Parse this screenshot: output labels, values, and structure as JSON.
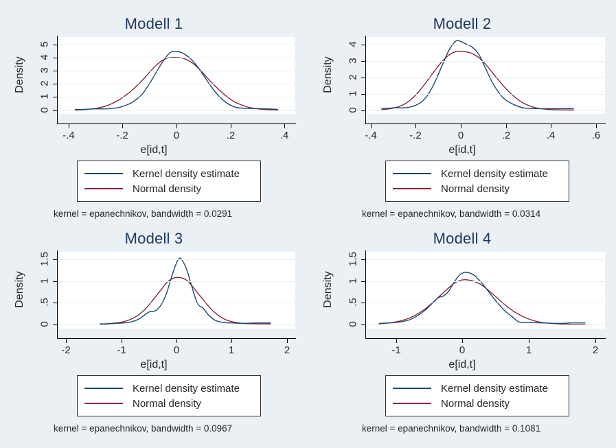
{
  "figure": {
    "background_color": "#eaf0f3",
    "plot_background_color": "#ffffff",
    "title_color": "#1f3864"
  },
  "legend": {
    "kernel_label": "Kernel density estimate",
    "normal_label": "Normal density",
    "kernel_color": "#1a476f",
    "normal_color": "#85293a"
  },
  "panels": [
    {
      "title": "Modell 1",
      "note": "kernel = epanechnikov, bandwidth = 0.0291",
      "xlabel": "e[id,t]",
      "ylabel": "Density",
      "xticks": [
        "-.4",
        "-.2",
        "0",
        ".2",
        ".4"
      ],
      "yticks": [
        "0",
        "1",
        "2",
        "3",
        "4",
        "5"
      ]
    },
    {
      "title": "Modell 2",
      "note": "kernel = epanechnikov, bandwidth = 0.0314",
      "xlabel": "e[id,t]",
      "ylabel": "Density",
      "xticks": [
        "-.4",
        "-.2",
        "0",
        ".2",
        ".4",
        ".6"
      ],
      "yticks": [
        "0",
        "1",
        "2",
        "3",
        "4"
      ]
    },
    {
      "title": "Modell 3",
      "note": "kernel = epanechnikov, bandwidth = 0.0967",
      "xlabel": "e[id,t]",
      "ylabel": "Density",
      "xticks": [
        "-2",
        "-1",
        "0",
        "1",
        "2"
      ],
      "yticks": [
        "0",
        ".5",
        "1",
        "1.5"
      ]
    },
    {
      "title": "Modell 4",
      "note": "kernel = epanechnikov, bandwidth = 0.1081",
      "xlabel": "e[id,t]",
      "ylabel": "Density",
      "xticks": [
        "-1",
        "0",
        "1",
        "2"
      ],
      "yticks": [
        "0",
        ".5",
        "1",
        "1.5"
      ]
    }
  ],
  "chart_data": [
    {
      "type": "line",
      "title": "Modell 1",
      "xlabel": "e[id,t]",
      "ylabel": "Density",
      "xlim": [
        -0.44,
        0.44
      ],
      "ylim": [
        -0.28,
        5.55
      ],
      "xticks": [
        -0.4,
        -0.2,
        0,
        0.2,
        0.4
      ],
      "yticks": [
        0,
        1,
        2,
        3,
        4,
        5
      ],
      "grid": true,
      "legend_position": "below-plot",
      "annotation": "kernel = epanechnikov, bandwidth = 0.0291",
      "series": [
        {
          "name": "Kernel density estimate",
          "color": "#1a476f",
          "x": [
            -0.375,
            -0.34,
            -0.3,
            -0.26,
            -0.22,
            -0.19,
            -0.16,
            -0.13,
            -0.11,
            -0.09,
            -0.07,
            -0.05,
            -0.03,
            -0.015,
            0.0,
            0.015,
            0.03,
            0.05,
            0.07,
            0.09,
            0.11,
            0.13,
            0.16,
            0.19,
            0.22,
            0.26,
            0.3,
            0.34,
            0.375
          ],
          "y": [
            0.05,
            0.06,
            0.1,
            0.1,
            0.18,
            0.35,
            0.65,
            1.15,
            1.7,
            2.35,
            3.05,
            3.7,
            4.25,
            4.45,
            4.45,
            4.4,
            4.25,
            3.95,
            3.5,
            2.95,
            2.35,
            1.75,
            1.0,
            0.5,
            0.22,
            0.14,
            0.12,
            0.1,
            0.06
          ]
        },
        {
          "name": "Normal density",
          "color": "#85293a",
          "x": [
            -0.375,
            -0.34,
            -0.3,
            -0.26,
            -0.22,
            -0.19,
            -0.16,
            -0.13,
            -0.11,
            -0.09,
            -0.07,
            -0.05,
            -0.03,
            -0.015,
            0.0,
            0.015,
            0.03,
            0.05,
            0.07,
            0.09,
            0.11,
            0.13,
            0.16,
            0.19,
            0.22,
            0.26,
            0.3,
            0.34,
            0.375
          ],
          "y": [
            0.02,
            0.05,
            0.13,
            0.32,
            0.7,
            1.1,
            1.6,
            2.2,
            2.65,
            3.1,
            3.5,
            3.8,
            3.97,
            4.0,
            4.0,
            3.98,
            3.9,
            3.7,
            3.4,
            3.0,
            2.55,
            2.1,
            1.5,
            0.98,
            0.58,
            0.26,
            0.1,
            0.04,
            0.02
          ]
        }
      ]
    },
    {
      "type": "line",
      "title": "Modell 2",
      "xlabel": "e[id,t]",
      "ylabel": "Density",
      "xlim": [
        -0.42,
        0.64
      ],
      "ylim": [
        -0.22,
        4.45
      ],
      "xticks": [
        -0.4,
        -0.2,
        0,
        0.2,
        0.4,
        0.6
      ],
      "yticks": [
        0,
        1,
        2,
        3,
        4
      ],
      "grid": true,
      "legend_position": "below-plot",
      "annotation": "kernel = epanechnikov, bandwidth = 0.0314",
      "series": [
        {
          "name": "Kernel density estimate",
          "color": "#1a476f",
          "x": [
            -0.35,
            -0.32,
            -0.29,
            -0.26,
            -0.23,
            -0.2,
            -0.17,
            -0.14,
            -0.11,
            -0.08,
            -0.05,
            -0.02,
            0.0,
            0.02,
            0.05,
            0.08,
            0.11,
            0.14,
            0.17,
            0.2,
            0.24,
            0.28,
            0.33,
            0.38,
            0.43,
            0.48,
            0.5
          ],
          "y": [
            0.12,
            0.12,
            0.16,
            0.14,
            0.18,
            0.3,
            0.55,
            1.05,
            1.85,
            2.8,
            3.7,
            4.22,
            4.18,
            4.05,
            3.85,
            3.4,
            2.55,
            1.7,
            1.05,
            0.62,
            0.32,
            0.14,
            0.1,
            0.1,
            0.1,
            0.1,
            0.1
          ]
        },
        {
          "name": "Normal density",
          "color": "#85293a",
          "x": [
            -0.35,
            -0.32,
            -0.29,
            -0.26,
            -0.23,
            -0.2,
            -0.17,
            -0.14,
            -0.11,
            -0.08,
            -0.05,
            -0.02,
            0.0,
            0.02,
            0.05,
            0.08,
            0.11,
            0.14,
            0.17,
            0.2,
            0.24,
            0.28,
            0.33,
            0.38,
            0.43,
            0.48,
            0.5
          ],
          "y": [
            0.04,
            0.08,
            0.16,
            0.3,
            0.55,
            0.92,
            1.4,
            1.95,
            2.5,
            3.0,
            3.38,
            3.57,
            3.58,
            3.56,
            3.45,
            3.2,
            2.8,
            2.3,
            1.8,
            1.32,
            0.8,
            0.42,
            0.16,
            0.06,
            0.03,
            0.02,
            0.02
          ]
        }
      ]
    },
    {
      "type": "line",
      "title": "Modell 3",
      "xlabel": "e[id,t]",
      "ylabel": "Density",
      "xlim": [
        -2.15,
        2.15
      ],
      "ylim": [
        -0.09,
        1.67
      ],
      "xticks": [
        -2,
        -1,
        0,
        1,
        2
      ],
      "yticks": [
        0,
        0.5,
        1,
        1.5
      ],
      "grid": true,
      "legend_position": "below-plot",
      "annotation": "kernel = epanechnikov, bandwidth = 0.0967",
      "series": [
        {
          "name": "Kernel density estimate",
          "color": "#1a476f",
          "x": [
            -1.38,
            -1.25,
            -1.1,
            -0.95,
            -0.8,
            -0.68,
            -0.58,
            -0.48,
            -0.38,
            -0.28,
            -0.18,
            -0.1,
            -0.02,
            0.05,
            0.1,
            0.18,
            0.26,
            0.34,
            0.4,
            0.48,
            0.58,
            0.7,
            0.85,
            1.0,
            1.2,
            1.45,
            1.7
          ],
          "y": [
            0.02,
            0.02,
            0.03,
            0.04,
            0.07,
            0.13,
            0.22,
            0.3,
            0.32,
            0.45,
            0.72,
            1.05,
            1.35,
            1.52,
            1.48,
            1.28,
            0.95,
            0.62,
            0.45,
            0.38,
            0.22,
            0.1,
            0.05,
            0.04,
            0.03,
            0.04,
            0.04
          ]
        },
        {
          "name": "Normal density",
          "color": "#85293a",
          "x": [
            -1.38,
            -1.25,
            -1.1,
            -0.95,
            -0.8,
            -0.68,
            -0.58,
            -0.48,
            -0.38,
            -0.28,
            -0.18,
            -0.1,
            -0.02,
            0.05,
            0.1,
            0.18,
            0.26,
            0.34,
            0.4,
            0.48,
            0.58,
            0.7,
            0.85,
            1.0,
            1.2,
            1.45,
            1.7
          ],
          "y": [
            0.01,
            0.02,
            0.04,
            0.07,
            0.14,
            0.23,
            0.34,
            0.48,
            0.64,
            0.8,
            0.96,
            1.04,
            1.08,
            1.08,
            1.07,
            1.02,
            0.92,
            0.8,
            0.7,
            0.58,
            0.42,
            0.27,
            0.14,
            0.07,
            0.03,
            0.02,
            0.02
          ]
        }
      ]
    },
    {
      "type": "line",
      "title": "Modell 4",
      "xlabel": "e[id,t]",
      "ylabel": "Density",
      "xlim": [
        -1.45,
        2.15
      ],
      "ylim": [
        -0.09,
        1.67
      ],
      "xticks": [
        -1,
        0,
        1,
        2
      ],
      "yticks": [
        0,
        0.5,
        1,
        1.5
      ],
      "grid": true,
      "legend_position": "below-plot",
      "annotation": "kernel = epanechnikov, bandwidth = 0.1081",
      "series": [
        {
          "name": "Kernel density estimate",
          "color": "#1a476f",
          "x": [
            -1.25,
            -1.1,
            -0.95,
            -0.8,
            -0.68,
            -0.56,
            -0.46,
            -0.36,
            -0.28,
            -0.2,
            -0.12,
            -0.04,
            0.04,
            0.1,
            0.18,
            0.28,
            0.4,
            0.52,
            0.64,
            0.76,
            0.86,
            1.0,
            1.2,
            1.45,
            1.65,
            1.85
          ],
          "y": [
            0.03,
            0.04,
            0.06,
            0.11,
            0.2,
            0.33,
            0.48,
            0.62,
            0.66,
            0.78,
            0.98,
            1.14,
            1.2,
            1.19,
            1.13,
            0.98,
            0.75,
            0.52,
            0.32,
            0.17,
            0.06,
            0.05,
            0.04,
            0.03,
            0.04,
            0.04
          ]
        },
        {
          "name": "Normal density",
          "color": "#85293a",
          "x": [
            -1.25,
            -1.1,
            -0.95,
            -0.8,
            -0.68,
            -0.56,
            -0.46,
            -0.36,
            -0.28,
            -0.2,
            -0.12,
            -0.04,
            0.04,
            0.1,
            0.18,
            0.28,
            0.4,
            0.52,
            0.64,
            0.76,
            0.86,
            1.0,
            1.2,
            1.45,
            1.65,
            1.85
          ],
          "y": [
            0.02,
            0.04,
            0.08,
            0.15,
            0.24,
            0.36,
            0.49,
            0.63,
            0.74,
            0.85,
            0.95,
            1.01,
            1.03,
            1.02,
            0.99,
            0.92,
            0.78,
            0.62,
            0.46,
            0.32,
            0.23,
            0.13,
            0.05,
            0.02,
            0.01,
            0.01
          ]
        }
      ]
    }
  ]
}
